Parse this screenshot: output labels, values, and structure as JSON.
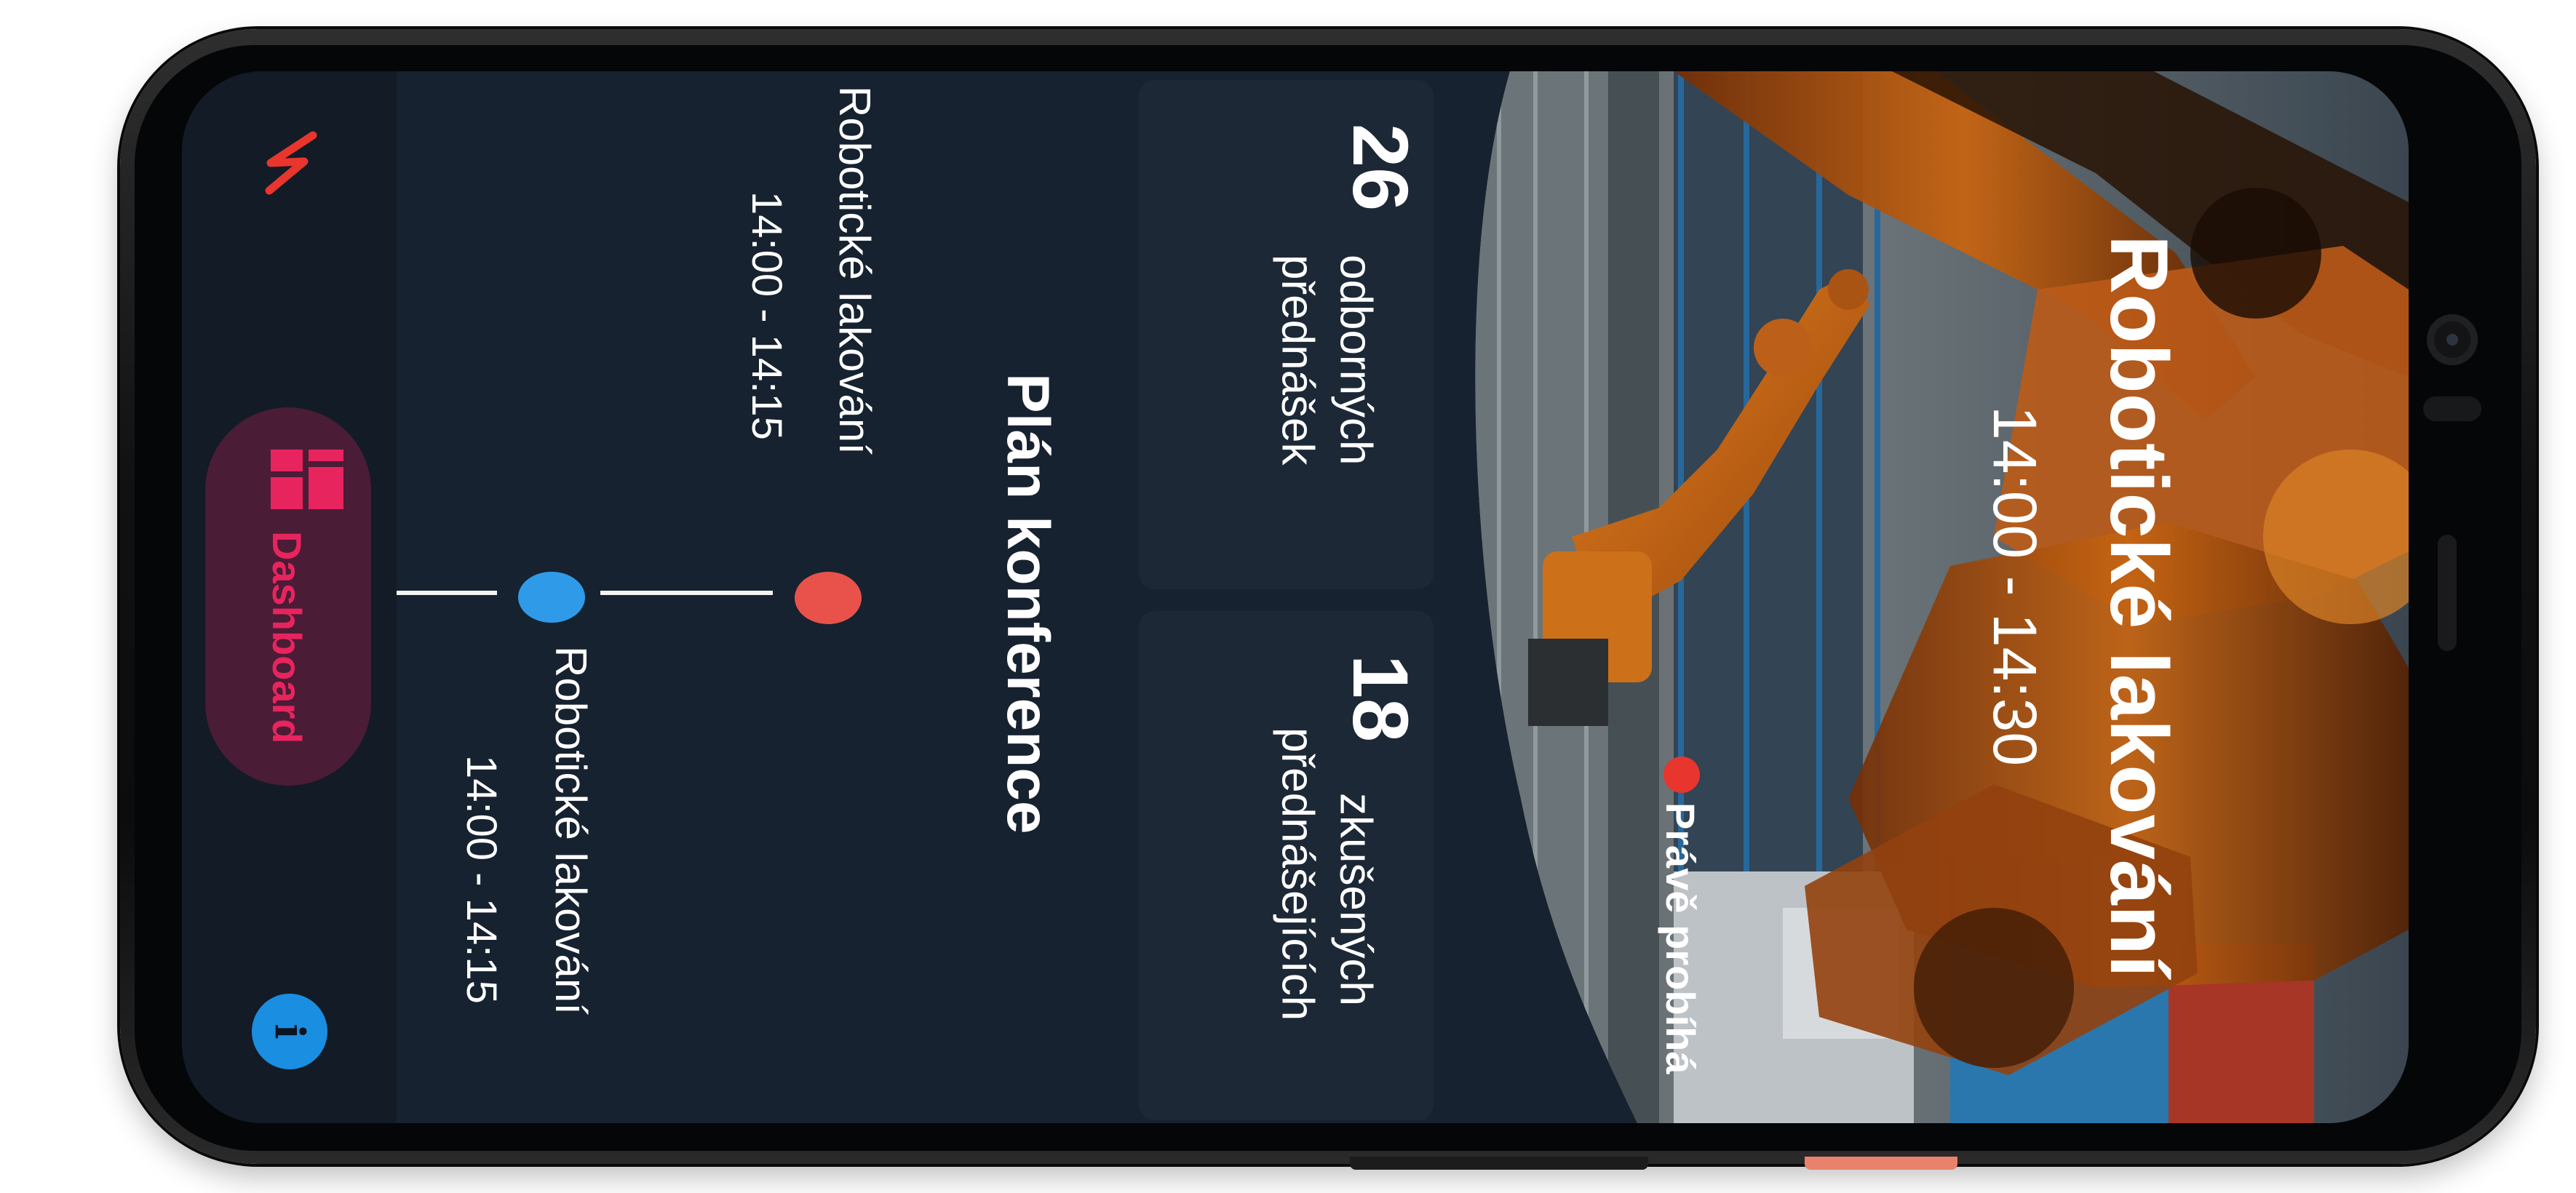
{
  "nav": {
    "dashboard_label": "Dashboard",
    "info_glyph": "i",
    "logo_icon": "zigzag-logo-icon",
    "dashboard_icon": "dashboard-grid-icon"
  },
  "schedule": {
    "title": "Plán konference",
    "items": [
      {
        "title": "Robotické lakování",
        "time": "14:00 - 14:15",
        "status_color": "#e8524a"
      },
      {
        "title": "Robotické lakování",
        "time": "14:00 - 14:15",
        "status_color": "#2f9be8"
      }
    ]
  },
  "stats": [
    {
      "value": "26",
      "label_line1": "odborných",
      "label_line2": "přednášek"
    },
    {
      "value": "18",
      "label_line1": "zkušených",
      "label_line2": "přednášejících"
    }
  ],
  "hero": {
    "title": "Robotické lakování",
    "time": "14:00 - 14:30",
    "status": "Právě probíhá",
    "status_color": "#e8352e"
  },
  "colors": {
    "background": "#172230",
    "rail": "#121b26",
    "accent_pink": "#e8245e",
    "pill": "#4a1c36",
    "info_blue": "#1a8ee0"
  }
}
